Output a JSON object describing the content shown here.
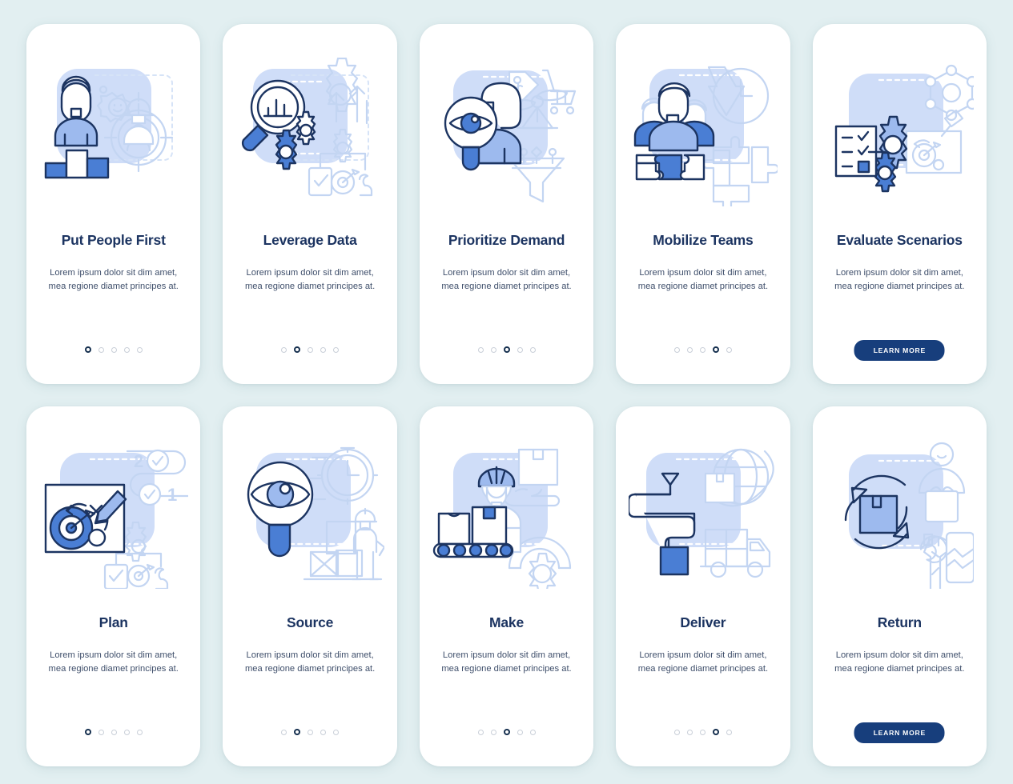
{
  "page": {
    "background_color": "#e2eff1",
    "card_background": "#ffffff",
    "title_color": "#1c3461",
    "body_color": "#3f4f6b",
    "accent_color": "#4a7ed4",
    "cta_color": "#173e7c",
    "dot_active_color": "#16304f",
    "dot_inactive_color": "#c9cfd8"
  },
  "body_text": "Lorem ipsum dolor sit dim amet, mea regione diamet principes at.",
  "cta_label": "LEARN MORE",
  "rows": [
    {
      "name": "row-one",
      "cards": [
        {
          "title": "Put People First",
          "body": "Lorem ipsum dolor sit dim amet, mea regione diamet principes at.",
          "dots": 5,
          "active_dot": 1,
          "footer": "dots",
          "illustration": "people-first-illustration"
        },
        {
          "title": "Leverage Data",
          "body": "Lorem ipsum dolor sit dim amet, mea regione diamet principes at.",
          "dots": 5,
          "active_dot": 2,
          "footer": "dots",
          "illustration": "leverage-data-illustration"
        },
        {
          "title": "Prioritize Demand",
          "body": "Lorem ipsum dolor sit dim amet, mea regione diamet principes at.",
          "dots": 5,
          "active_dot": 3,
          "footer": "dots",
          "illustration": "prioritize-demand-illustration"
        },
        {
          "title": "Mobilize Teams",
          "body": "Lorem ipsum dolor sit dim amet, mea regione diamet principes at.",
          "dots": 5,
          "active_dot": 4,
          "footer": "dots",
          "illustration": "mobilize-teams-illustration"
        },
        {
          "title": "Evaluate Scenarios",
          "body": "Lorem ipsum dolor sit dim amet, mea regione diamet principes at.",
          "dots": 0,
          "active_dot": 0,
          "footer": "button",
          "cta": "LEARN MORE",
          "illustration": "evaluate-scenarios-illustration"
        }
      ]
    },
    {
      "name": "row-two",
      "cards": [
        {
          "title": "Plan",
          "body": "Lorem ipsum dolor sit dim amet, mea regione diamet principes at.",
          "dots": 5,
          "active_dot": 1,
          "footer": "dots",
          "illustration": "plan-illustration"
        },
        {
          "title": "Source",
          "body": "Lorem ipsum dolor sit dim amet, mea regione diamet principes at.",
          "dots": 5,
          "active_dot": 2,
          "footer": "dots",
          "illustration": "source-illustration"
        },
        {
          "title": "Make",
          "body": "Lorem ipsum dolor sit dim amet, mea regione diamet principes at.",
          "dots": 5,
          "active_dot": 3,
          "footer": "dots",
          "illustration": "make-illustration"
        },
        {
          "title": "Deliver",
          "body": "Lorem ipsum dolor sit dim amet, mea regione diamet principes at.",
          "dots": 5,
          "active_dot": 4,
          "footer": "dots",
          "illustration": "deliver-illustration"
        },
        {
          "title": "Return",
          "body": "Lorem ipsum dolor sit dim amet, mea regione diamet principes at.",
          "dots": 0,
          "active_dot": 0,
          "footer": "button",
          "cta": "LEARN MORE",
          "illustration": "return-illustration"
        }
      ]
    }
  ]
}
